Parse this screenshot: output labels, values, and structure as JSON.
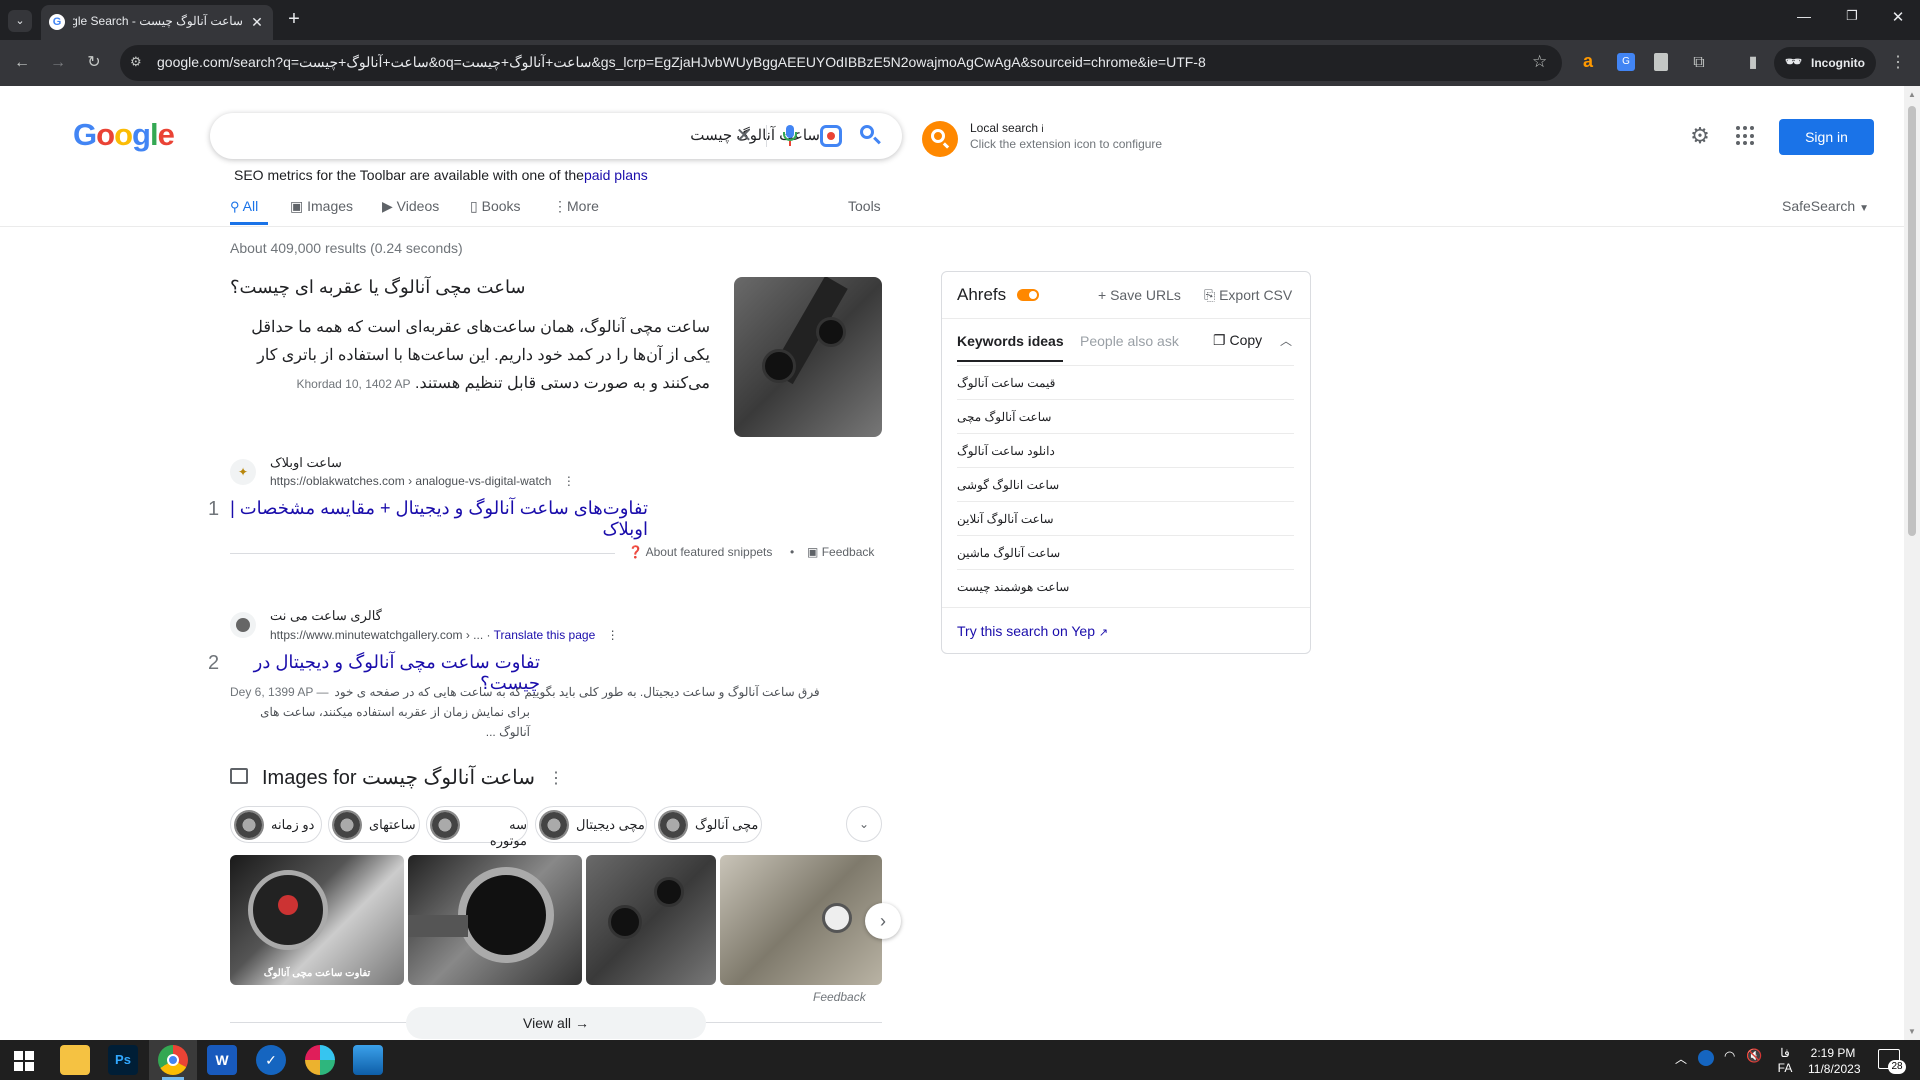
{
  "browser": {
    "tab_title": "ساعت آنالوگ چیست - Google Search",
    "url": "google.com/search?q=ساعت+آنالوگ+چیست&oq=ساعت+آنالوگ+چیست&gs_lcrp=EgZjaHJvbWUyBggAEEUYOdIBBzE5N2owajmoAgCwAgA&sourceid=chrome&ie=UTF-8",
    "incognito_label": "Incognito"
  },
  "google": {
    "logo": "Google",
    "query": "ساعت آنالوگ چیست",
    "local_search_title": "Local search",
    "local_search_info": "i",
    "local_search_sub": "Click the extension icon to configure",
    "sign_in": "Sign in",
    "seo_notice": "SEO metrics for the Toolbar are available with one of the",
    "seo_link": "paid plans",
    "tabs": [
      "All",
      "Images",
      "Videos",
      "Books",
      "More"
    ],
    "tools": "Tools",
    "safesearch": "SafeSearch",
    "result_stats": "About 409,000 results (0.24 seconds)"
  },
  "featured": {
    "heading": "ساعت مچی آنالوگ یا عقربه ای چیست؟",
    "text": "ساعت مچی آنالوگ، همان ساعت‌های عقربه‌ای است که همه ما حداقل یکی از آن‌ها را در کمد خود داریم. این ساعت‌ها با استفاده از باتری کار می‌کنند و به صورت دستی قابل تنظیم هستند.",
    "date": "Khordad 10, 1402 AP",
    "site_name": "ساعت اوبلاک",
    "site_url": "https://oblakwatches.com › analogue-vs-digital-watch",
    "rank": "1",
    "title": "تفاوت‌های ساعت آنالوگ و دیجیتال + مقایسه مشخصات | اوبلاک",
    "about": "About featured snippets",
    "feedback": "Feedback"
  },
  "result2": {
    "site_name": "گالری ساعت می نت",
    "site_url": "https://www.minutewatchgallery.com › ...",
    "translate": "Translate this page",
    "rank": "2",
    "title": "تفاوت ساعت مچی آنالوگ و دیجیتال در چیست؟",
    "date": "Dey 6, 1399 AP —",
    "snippet1": "فرق ساعت آنالوگ و ساعت دیجیتال. به طور کلی باید بگوییم که به ساعت هایی که در صفحه ی خود",
    "snippet2": "برای نمایش زمان از عقربه استفاده میکنند، ساعت های آنالوگ ..."
  },
  "images": {
    "heading_prefix": "Images for",
    "heading_query": "ساعت آنالوگ چیست",
    "chips": [
      "مچی آنالوگ",
      "مچی دیجیتال",
      "سه موتوره",
      "ساعتهای",
      "دو زمانه"
    ],
    "first_image_caption": "تفاوت ساعت مچی آنالوگ",
    "feedback": "Feedback",
    "view_all": "View all"
  },
  "ahrefs": {
    "title": "Ahrefs",
    "save_urls": "Save URLs",
    "export_csv": "Export CSV",
    "tab_keywords": "Keywords ideas",
    "tab_people": "People also ask",
    "copy": "Copy",
    "keywords": [
      "قیمت ساعت آنالوگ",
      "ساعت آنالوگ مچی",
      "دانلود ساعت آنالوگ",
      "ساعت انالوگ گوشی",
      "ساعت آنالوگ آنلاین",
      "ساعت آنالوگ ماشین",
      "ساعت هوشمند چیست"
    ],
    "try_yep": "Try this search on Yep"
  },
  "taskbar": {
    "lang": "فا",
    "lang2": "FA",
    "time": "2:19 PM",
    "date": "11/8/2023",
    "notif_count": "28"
  },
  "colors": {
    "google_blue": "#1a73e8",
    "link": "#1a0dab",
    "ahrefs_orange": "#ff8800",
    "chrome_dark": "#202124"
  }
}
